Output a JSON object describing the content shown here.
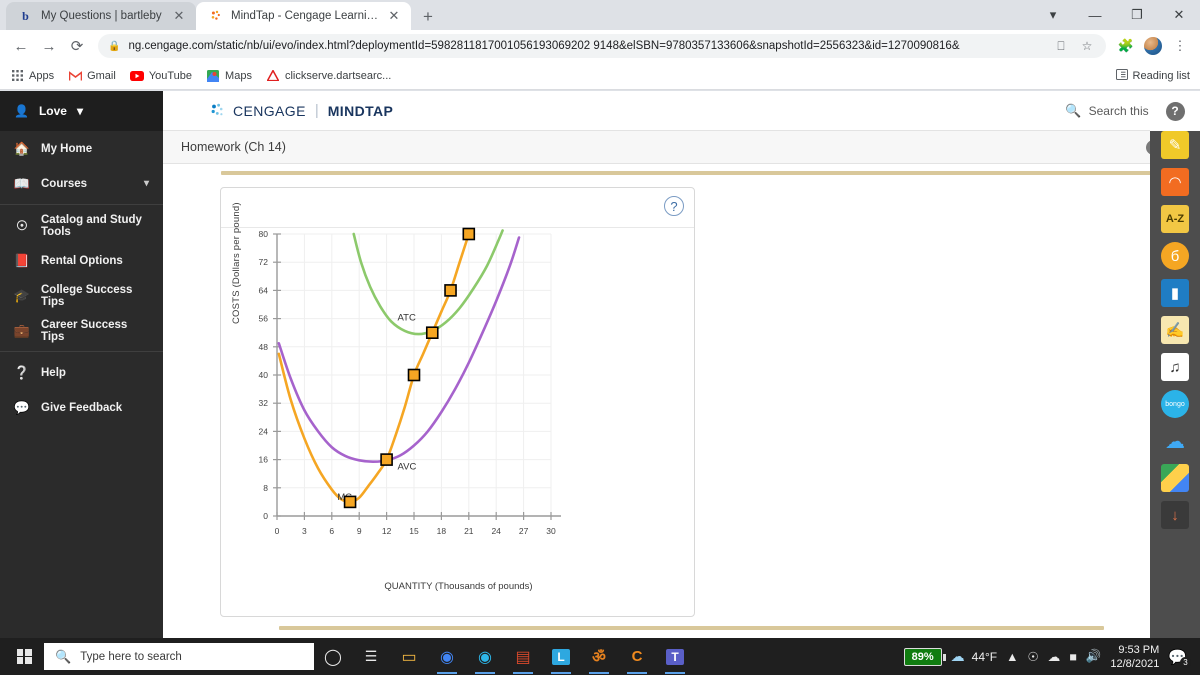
{
  "browser": {
    "tabs": [
      {
        "title": "My Questions | bartleby",
        "favicon": "bartleby-b-icon",
        "active": false
      },
      {
        "title": "MindTap - Cengage Learning",
        "favicon": "cengage-icon",
        "active": true
      }
    ],
    "new_tab_label": "+",
    "window_controls": [
      "chevron-down",
      "minimize",
      "restore",
      "close"
    ],
    "url": "ng.cengage.com/static/nb/ui/evo/index.html?deploymentId=598281181700105619306920291 48&elSBN=9780357133606&snapshotId=2556323&id=1270090816&",
    "url_display": "ng.cengage.com/static/nb/ui/evo/index.html?deploymentId=5982811817001056193069202 9148&elSBN=9780357133606&snapshotId=2556323&id=1270090816&",
    "bookmarks": [
      {
        "label": "Apps",
        "icon": "apps-grid-icon"
      },
      {
        "label": "Gmail",
        "icon": "gmail-icon"
      },
      {
        "label": "YouTube",
        "icon": "youtube-icon"
      },
      {
        "label": "Maps",
        "icon": "maps-icon"
      },
      {
        "label": "clickserve.dartsearc...",
        "icon": "adobe-icon"
      }
    ],
    "reading_list": "Reading list"
  },
  "sidebar": {
    "user": "Love",
    "items": [
      {
        "label": "My Home",
        "icon": "home-icon"
      },
      {
        "label": "Courses",
        "icon": "book-icon",
        "chevron": true
      },
      {
        "label": "Catalog and Study Tools",
        "icon": "compass-icon"
      },
      {
        "label": "Rental Options",
        "icon": "open-book-icon"
      },
      {
        "label": "College Success Tips",
        "icon": "graduation-cap-icon"
      },
      {
        "label": "Career Success Tips",
        "icon": "briefcase-icon"
      },
      {
        "label": "Help",
        "icon": "question-circle-icon"
      },
      {
        "label": "Give Feedback",
        "icon": "feedback-icon"
      }
    ],
    "collapse_label": "«"
  },
  "header": {
    "brand_primary": "CENGAGE",
    "brand_secondary": "MINDTAP",
    "search_label": "Search this course",
    "help_label": "?"
  },
  "breadcrumb": {
    "title": "Homework (Ch 14)",
    "info_label": "i",
    "close_label": "✕"
  },
  "question_card": {
    "help_label": "?"
  },
  "app_rail": [
    {
      "name": "highlighter-pen-icon",
      "glyph": "✎",
      "color": "#f0c929"
    },
    {
      "name": "rss-feed-icon",
      "glyph": "◠",
      "color": "#f26c21"
    },
    {
      "name": "glossary-az-icon",
      "glyph": "A-Z",
      "color": "#f2c744"
    },
    {
      "name": "brainhoney-icon",
      "glyph": "б",
      "color": "#f5a623"
    },
    {
      "name": "ebook-icon",
      "glyph": "▮",
      "color": "#1f7dc4"
    },
    {
      "name": "notes-icon",
      "glyph": "✍",
      "color": "#f7e7b0"
    },
    {
      "name": "read-aloud-icon",
      "glyph": "♫",
      "color": "#ffffff"
    },
    {
      "name": "bongo-icon",
      "glyph": "bongo",
      "color": "#2bb3e8"
    },
    {
      "name": "onedrive-icon",
      "glyph": "☁",
      "color": "#3fa9f5"
    },
    {
      "name": "google-drive-icon",
      "glyph": "△",
      "color": "#ffd04b"
    },
    {
      "name": "download-icon",
      "glyph": "↓",
      "color": "#e0e0e0"
    }
  ],
  "scrollbar": {
    "up": "▲",
    "down": "▼"
  },
  "taskbar": {
    "search_placeholder": "Type here to search",
    "cortana_icon": "cortana-circle-icon",
    "taskview_icon": "task-view-icon",
    "apps": [
      {
        "name": "file-explorer-icon",
        "glyph": "▭",
        "color": "#f5b942"
      },
      {
        "name": "google-chrome-icon",
        "glyph": "◉",
        "color": "#4285f4",
        "running": true
      },
      {
        "name": "microsoft-edge-icon",
        "glyph": "◉",
        "color": "#2eb6e8",
        "running": true
      },
      {
        "name": "microsoft-store-icon",
        "glyph": "▤",
        "color": "#d8492b",
        "running": true
      },
      {
        "name": "lockdown-browser-icon",
        "glyph": "L",
        "color": "#2ea8e0",
        "running": true
      },
      {
        "name": "pearson-icon",
        "glyph": "ॐ",
        "color": "#e8821e",
        "running": true
      },
      {
        "name": "cengage-icon",
        "glyph": "C",
        "color": "#f08a1e",
        "running": true
      },
      {
        "name": "microsoft-teams-icon",
        "glyph": "T",
        "color": "#5a5fc7",
        "running": true
      }
    ],
    "battery": "89%",
    "temperature": "44°F",
    "weather_icon": "cloud-icon",
    "tray_icons": [
      "chevron-up-icon",
      "camera-icon",
      "onedrive-cloud-icon",
      "battery-icon",
      "volume-icon"
    ],
    "time": "9:53 PM",
    "date": "12/8/2021",
    "notification_count": "3"
  },
  "chart_data": {
    "type": "line",
    "title": "",
    "xlabel": "QUANTITY (Thousands of pounds)",
    "ylabel": "COSTS (Dollars per pound)",
    "xlim": [
      0,
      30
    ],
    "ylim": [
      0,
      80
    ],
    "xticks": [
      0,
      3,
      6,
      9,
      12,
      15,
      18,
      21,
      24,
      27,
      30
    ],
    "yticks": [
      0,
      8,
      16,
      24,
      32,
      40,
      48,
      56,
      64,
      72,
      80
    ],
    "grid": true,
    "series": [
      {
        "name": "MC",
        "label": "MC",
        "color": "#F5A623",
        "label_x": 6.6,
        "label_y": 4.6,
        "markers": [
          {
            "x": 8,
            "y": 4
          },
          {
            "x": 12,
            "y": 16
          },
          {
            "x": 15,
            "y": 40
          },
          {
            "x": 17,
            "y": 52
          },
          {
            "x": 19,
            "y": 64
          },
          {
            "x": 21,
            "y": 80
          }
        ],
        "points": [
          {
            "x": 0.2,
            "y": 46
          },
          {
            "x": 1.5,
            "y": 33
          },
          {
            "x": 3,
            "y": 22
          },
          {
            "x": 4.5,
            "y": 13.5
          },
          {
            "x": 6,
            "y": 7.5
          },
          {
            "x": 7,
            "y": 4.8
          },
          {
            "x": 8,
            "y": 4
          },
          {
            "x": 9,
            "y": 5.2
          },
          {
            "x": 10,
            "y": 8.5
          },
          {
            "x": 11,
            "y": 12
          },
          {
            "x": 12,
            "y": 16
          },
          {
            "x": 13,
            "y": 23
          },
          {
            "x": 14,
            "y": 31
          },
          {
            "x": 15,
            "y": 40
          },
          {
            "x": 16,
            "y": 46
          },
          {
            "x": 17,
            "y": 52
          },
          {
            "x": 18,
            "y": 58
          },
          {
            "x": 19,
            "y": 64
          },
          {
            "x": 20,
            "y": 72
          },
          {
            "x": 21,
            "y": 80
          }
        ]
      },
      {
        "name": "AVC",
        "label": "AVC",
        "color": "#A663CC",
        "label_x": 13.2,
        "label_y": 13.2,
        "points": [
          {
            "x": 0.2,
            "y": 49
          },
          {
            "x": 1.5,
            "y": 39
          },
          {
            "x": 3,
            "y": 30
          },
          {
            "x": 4.5,
            "y": 24
          },
          {
            "x": 6,
            "y": 19.5
          },
          {
            "x": 7.5,
            "y": 17
          },
          {
            "x": 9,
            "y": 15.8
          },
          {
            "x": 10.5,
            "y": 15.4
          },
          {
            "x": 12,
            "y": 15.8
          },
          {
            "x": 13.5,
            "y": 17.2
          },
          {
            "x": 15,
            "y": 20
          },
          {
            "x": 16.5,
            "y": 24
          },
          {
            "x": 18,
            "y": 29.5
          },
          {
            "x": 19.5,
            "y": 36
          },
          {
            "x": 21,
            "y": 43.5
          },
          {
            "x": 22.5,
            "y": 52
          },
          {
            "x": 24,
            "y": 61
          },
          {
            "x": 25.5,
            "y": 71
          },
          {
            "x": 26.5,
            "y": 79
          }
        ]
      },
      {
        "name": "ATC",
        "label": "ATC",
        "color": "#8CC96B",
        "label_x": 13.2,
        "label_y": 55.5,
        "points": [
          {
            "x": 8.4,
            "y": 80
          },
          {
            "x": 9.2,
            "y": 72
          },
          {
            "x": 10.2,
            "y": 65
          },
          {
            "x": 11.3,
            "y": 59.5
          },
          {
            "x": 12.5,
            "y": 55.2
          },
          {
            "x": 14,
            "y": 52.5
          },
          {
            "x": 15.5,
            "y": 51.6
          },
          {
            "x": 17,
            "y": 52.5
          },
          {
            "x": 18.5,
            "y": 55
          },
          {
            "x": 20,
            "y": 59
          },
          {
            "x": 21.5,
            "y": 64.5
          },
          {
            "x": 23,
            "y": 71
          },
          {
            "x": 24.3,
            "y": 78.5
          },
          {
            "x": 24.7,
            "y": 81
          }
        ]
      }
    ]
  }
}
